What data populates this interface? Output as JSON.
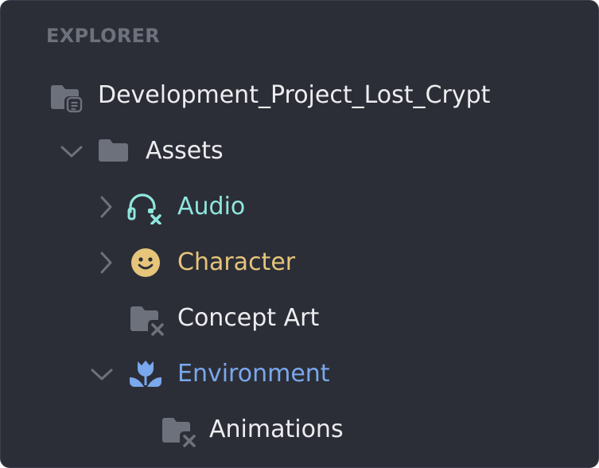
{
  "panel": {
    "title": "EXPLORER"
  },
  "tree": {
    "root": {
      "label": "Development_Project_Lost_Crypt",
      "icon": "project-folder-icon"
    },
    "assets": {
      "label": "Assets",
      "icon": "folder-icon",
      "expanded": true
    },
    "audio": {
      "label": "Audio",
      "icon": "headphones-icon",
      "expanded": false
    },
    "character": {
      "label": "Character",
      "icon": "smiley-icon",
      "expanded": false
    },
    "concept_art": {
      "label": "Concept Art",
      "icon": "folder-x-icon"
    },
    "environment": {
      "label": "Environment",
      "icon": "tulip-icon",
      "expanded": true
    },
    "animations": {
      "label": "Animations",
      "icon": "folder-x-icon"
    }
  },
  "colors": {
    "background": "#2c2e37",
    "text": "#ededf0",
    "muted": "#6d717c",
    "audio": "#8fe6dd",
    "character": "#e6c57a",
    "environment": "#79a8ec"
  }
}
